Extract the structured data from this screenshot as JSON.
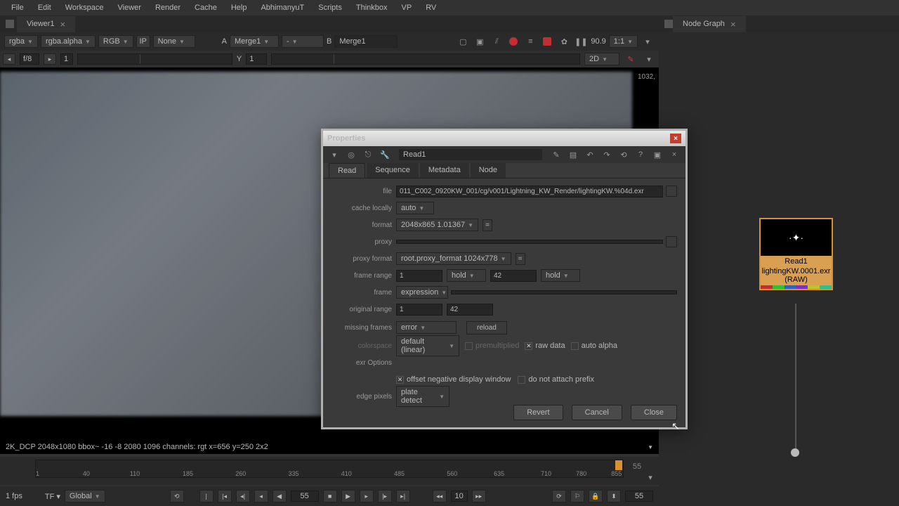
{
  "menu": [
    "File",
    "Edit",
    "Workspace",
    "Viewer",
    "Render",
    "Cache",
    "Help",
    "AbhimanyuT",
    "Scripts",
    "Thinkbox",
    "VP",
    "RV"
  ],
  "left_tab": "Viewer1",
  "right_tab": "Node Graph",
  "viewer_toolbar": {
    "ch1": "rgba",
    "ch2": "rgba.alpha",
    "ch3": "RGB",
    "proxy": "None",
    "a_label": "A",
    "a_val": "Merge1",
    "dash": "-",
    "b_label": "B",
    "b_val": "Merge1",
    "zoom": "90.9",
    "ratio": "1:1"
  },
  "toolbar2": {
    "fstop": "f/8",
    "frame": "1",
    "y_label": "Y",
    "y_val": "1",
    "dim": "2D"
  },
  "coord": "1032,",
  "info": "2K_DCP 2048x1080  bbox~ -16 -8 2080 1096 channels: rgt  x=656 y=250 2x2",
  "timeline": {
    "marks": [
      "1",
      "40",
      "110",
      "185",
      "260",
      "335",
      "410",
      "485",
      "560",
      "635",
      "710",
      "780",
      "855"
    ],
    "marks_lbl": [
      "1",
      "40",
      "110",
      "185",
      "260",
      "335",
      "410",
      "485",
      "560",
      "635",
      "710",
      "780",
      "855"
    ],
    "labels": [
      "1",
      "40",
      "110",
      "185",
      "260",
      "335",
      "410",
      "485",
      "560",
      "635",
      "710",
      "780",
      "855"
    ],
    "ruler_labels": [
      "1",
      "40",
      "110",
      "185",
      "260",
      "335",
      "410",
      "485",
      "560",
      "635",
      "710",
      "780",
      "855"
    ],
    "tick_labels": [
      "1",
      "40",
      "110",
      "185",
      "260",
      "335",
      "410",
      "485",
      "560",
      "635",
      "710",
      "780",
      "855"
    ],
    "lbls": {
      "p0": "1",
      "p1": "40",
      "p2": "110",
      "p3": "185",
      "p4": "260",
      "p5": "335",
      "p6": "410",
      "p7": "485",
      "p8": "560",
      "p9": "635",
      "p10": "710",
      "p11": "780",
      "p12": "855"
    },
    "lmarks": [
      "1",
      "40",
      "110",
      "185",
      "260",
      "335",
      "410",
      "485",
      "560",
      "635",
      "710",
      "780",
      "855"
    ],
    "ticks": [
      1,
      40,
      110,
      185,
      260,
      335,
      410,
      485,
      560,
      635,
      710,
      780,
      855
    ],
    "end": "55",
    "head": "55"
  },
  "tl": {
    "l1": "1",
    "l2": "40",
    "l3": "110",
    "l4": "185",
    "l5": "260",
    "l6": "335",
    "l7": "410",
    "l8": "485",
    "l9": "560",
    "l10": "635",
    "l11": "710",
    "l12": "780",
    "l13": "855",
    "head": "55",
    "end": "55"
  },
  "ticks": [
    "1",
    "40",
    "110",
    "185",
    "260",
    "335",
    "410",
    "485",
    "560",
    "635",
    "710",
    "780",
    "855"
  ],
  "play": {
    "fps": "1 fps",
    "tf": "TF ▾",
    "global": "Global",
    "cur": "55",
    "step": "10",
    "end": "55"
  },
  "dialog": {
    "title": "Properties",
    "node": "Read1",
    "tabs": [
      "Read",
      "Sequence",
      "Metadata",
      "Node"
    ],
    "file_lbl": "file",
    "file": "011_C002_0920KW_001/cg/v001/Lightning_KW_Render/lightingKW.%04d.exr",
    "cache_lbl": "cache locally",
    "cache": "auto",
    "format_lbl": "format",
    "format": "2048x865 1.01367",
    "proxy_lbl": "proxy",
    "proxy": "",
    "pformat_lbl": "proxy format",
    "pformat": "root.proxy_format 1024x778",
    "frange_lbl": "frame range",
    "frange_a": "1",
    "frange_m1": "hold",
    "frange_b": "42",
    "frange_m2": "hold",
    "frame_lbl": "frame",
    "frame": "expression",
    "orange_lbl": "original range",
    "orange_a": "1",
    "orange_b": "42",
    "missing_lbl": "missing frames",
    "missing": "error",
    "reload": "reload",
    "cspace_lbl": "colorspace",
    "cspace": "default (linear)",
    "premult": "premultiplied",
    "raw": "raw data",
    "autoa": "auto alpha",
    "exr_lbl": "exr Options",
    "offset": "offset negative display window",
    "prefix": "do not attach prefix",
    "edge_lbl": "edge pixels",
    "edge": "plate detect",
    "revert": "Revert",
    "cancel": "Cancel",
    "close": "Close"
  },
  "node_graph": {
    "name": "Read1",
    "file": "lightingKW.0001.exr",
    "raw": "(RAW)"
  },
  "tlbl": {
    "t1": "1",
    "t2": "40",
    "t3": "110",
    "t4": "185",
    "t5": "260",
    "t6": "335",
    "t7": "410",
    "t8": "485",
    "t9": "560",
    "t10": "635",
    "t11": "710",
    "t12": "780",
    "t13": "855"
  }
}
